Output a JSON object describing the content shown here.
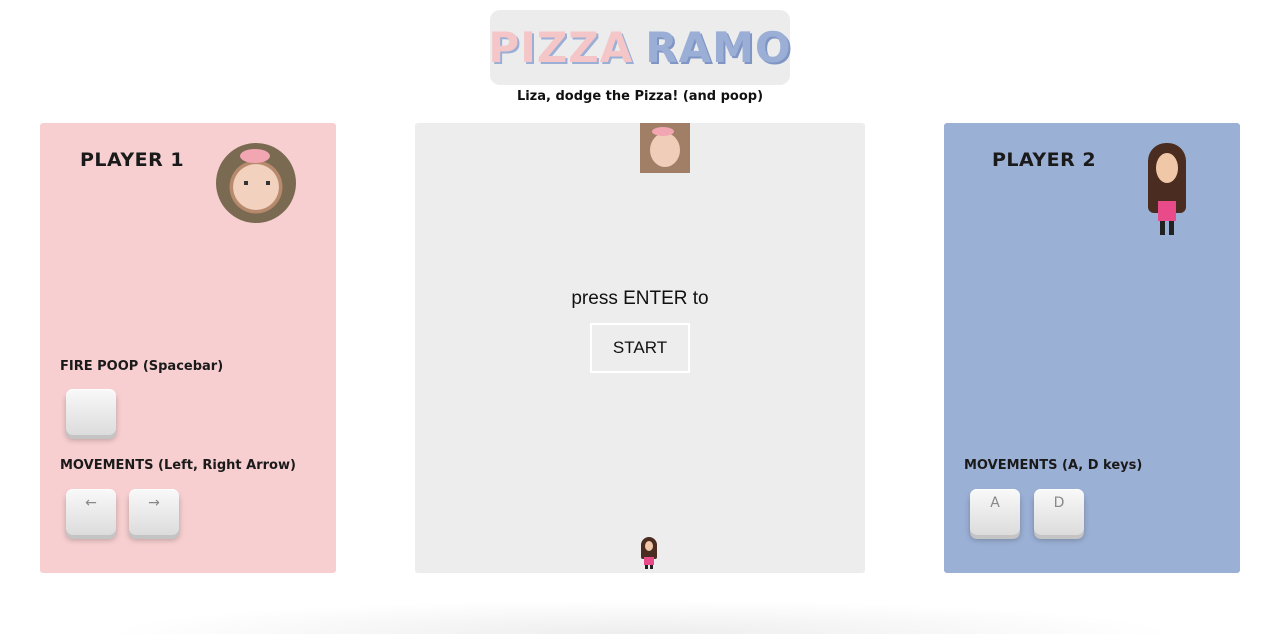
{
  "header": {
    "title_word1": "PIZZA",
    "title_word2": "RAMO",
    "subtitle": "Liza, dodge the Pizza! (and poop)"
  },
  "player1": {
    "title": "PLAYER 1",
    "fire_label": "FIRE POOP (Spacebar)",
    "fire_key": "",
    "movement_label": "MOVEMENTS (Left, Right Arrow)",
    "left_key": "←",
    "right_key": "→",
    "accent": "#f7cfd0"
  },
  "player2": {
    "title": "PLAYER 2",
    "movement_label": "MOVEMENTS (A, D keys)",
    "a_key": "A",
    "d_key": "D",
    "accent": "#9bb0d5"
  },
  "game": {
    "prompt": "press ENTER to",
    "start_label": "START",
    "background": "#ededed"
  }
}
